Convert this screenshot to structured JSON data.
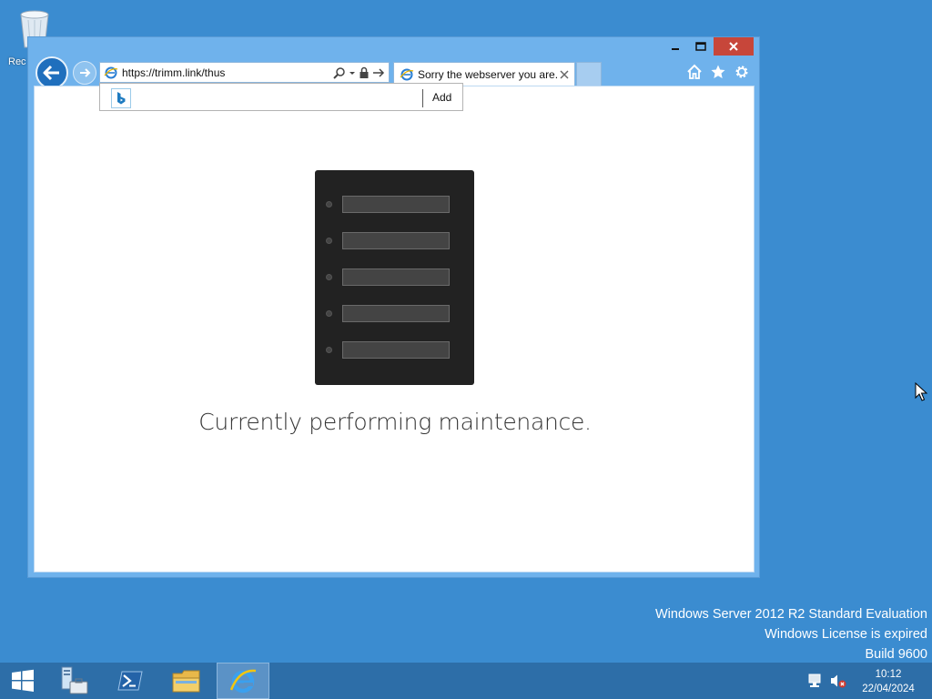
{
  "desktop": {
    "recycle_bin_label": "Rec",
    "watermark": {
      "line1": "Windows Server 2012 R2 Standard Evaluation",
      "line2": "Windows License is expired",
      "line3": "Build 9600"
    }
  },
  "browser": {
    "address": {
      "url": "https://trimm.link/thus",
      "icons": [
        "ie-favicon",
        "search-icon",
        "dropdown-icon",
        "lock-icon",
        "go-arrow-icon"
      ]
    },
    "tab": {
      "title": "Sorry the webserver you are..."
    },
    "suggestion": {
      "add_label": "Add",
      "provider_icon": "bing-icon"
    },
    "toolbar_icons": [
      "home-icon",
      "favorites-star-icon",
      "settings-gear-icon"
    ],
    "window_controls": [
      "minimize",
      "maximize",
      "close"
    ]
  },
  "page": {
    "message": "Currently performing maintenance.",
    "server_slot_count": 5
  },
  "taskbar": {
    "items": [
      "start",
      "server-manager",
      "powershell",
      "file-explorer",
      "internet-explorer"
    ],
    "active_item": "internet-explorer",
    "clock": {
      "time": "10:12",
      "date": "22/04/2024"
    },
    "tray_icons": [
      "network-icon",
      "volume-muted-icon"
    ]
  },
  "colors": {
    "desktop": "#3b8cd0",
    "window_frame": "#6fb2ec",
    "close_button": "#c7463a",
    "taskbar": "#2d6ea8",
    "server_body": "#222222"
  }
}
